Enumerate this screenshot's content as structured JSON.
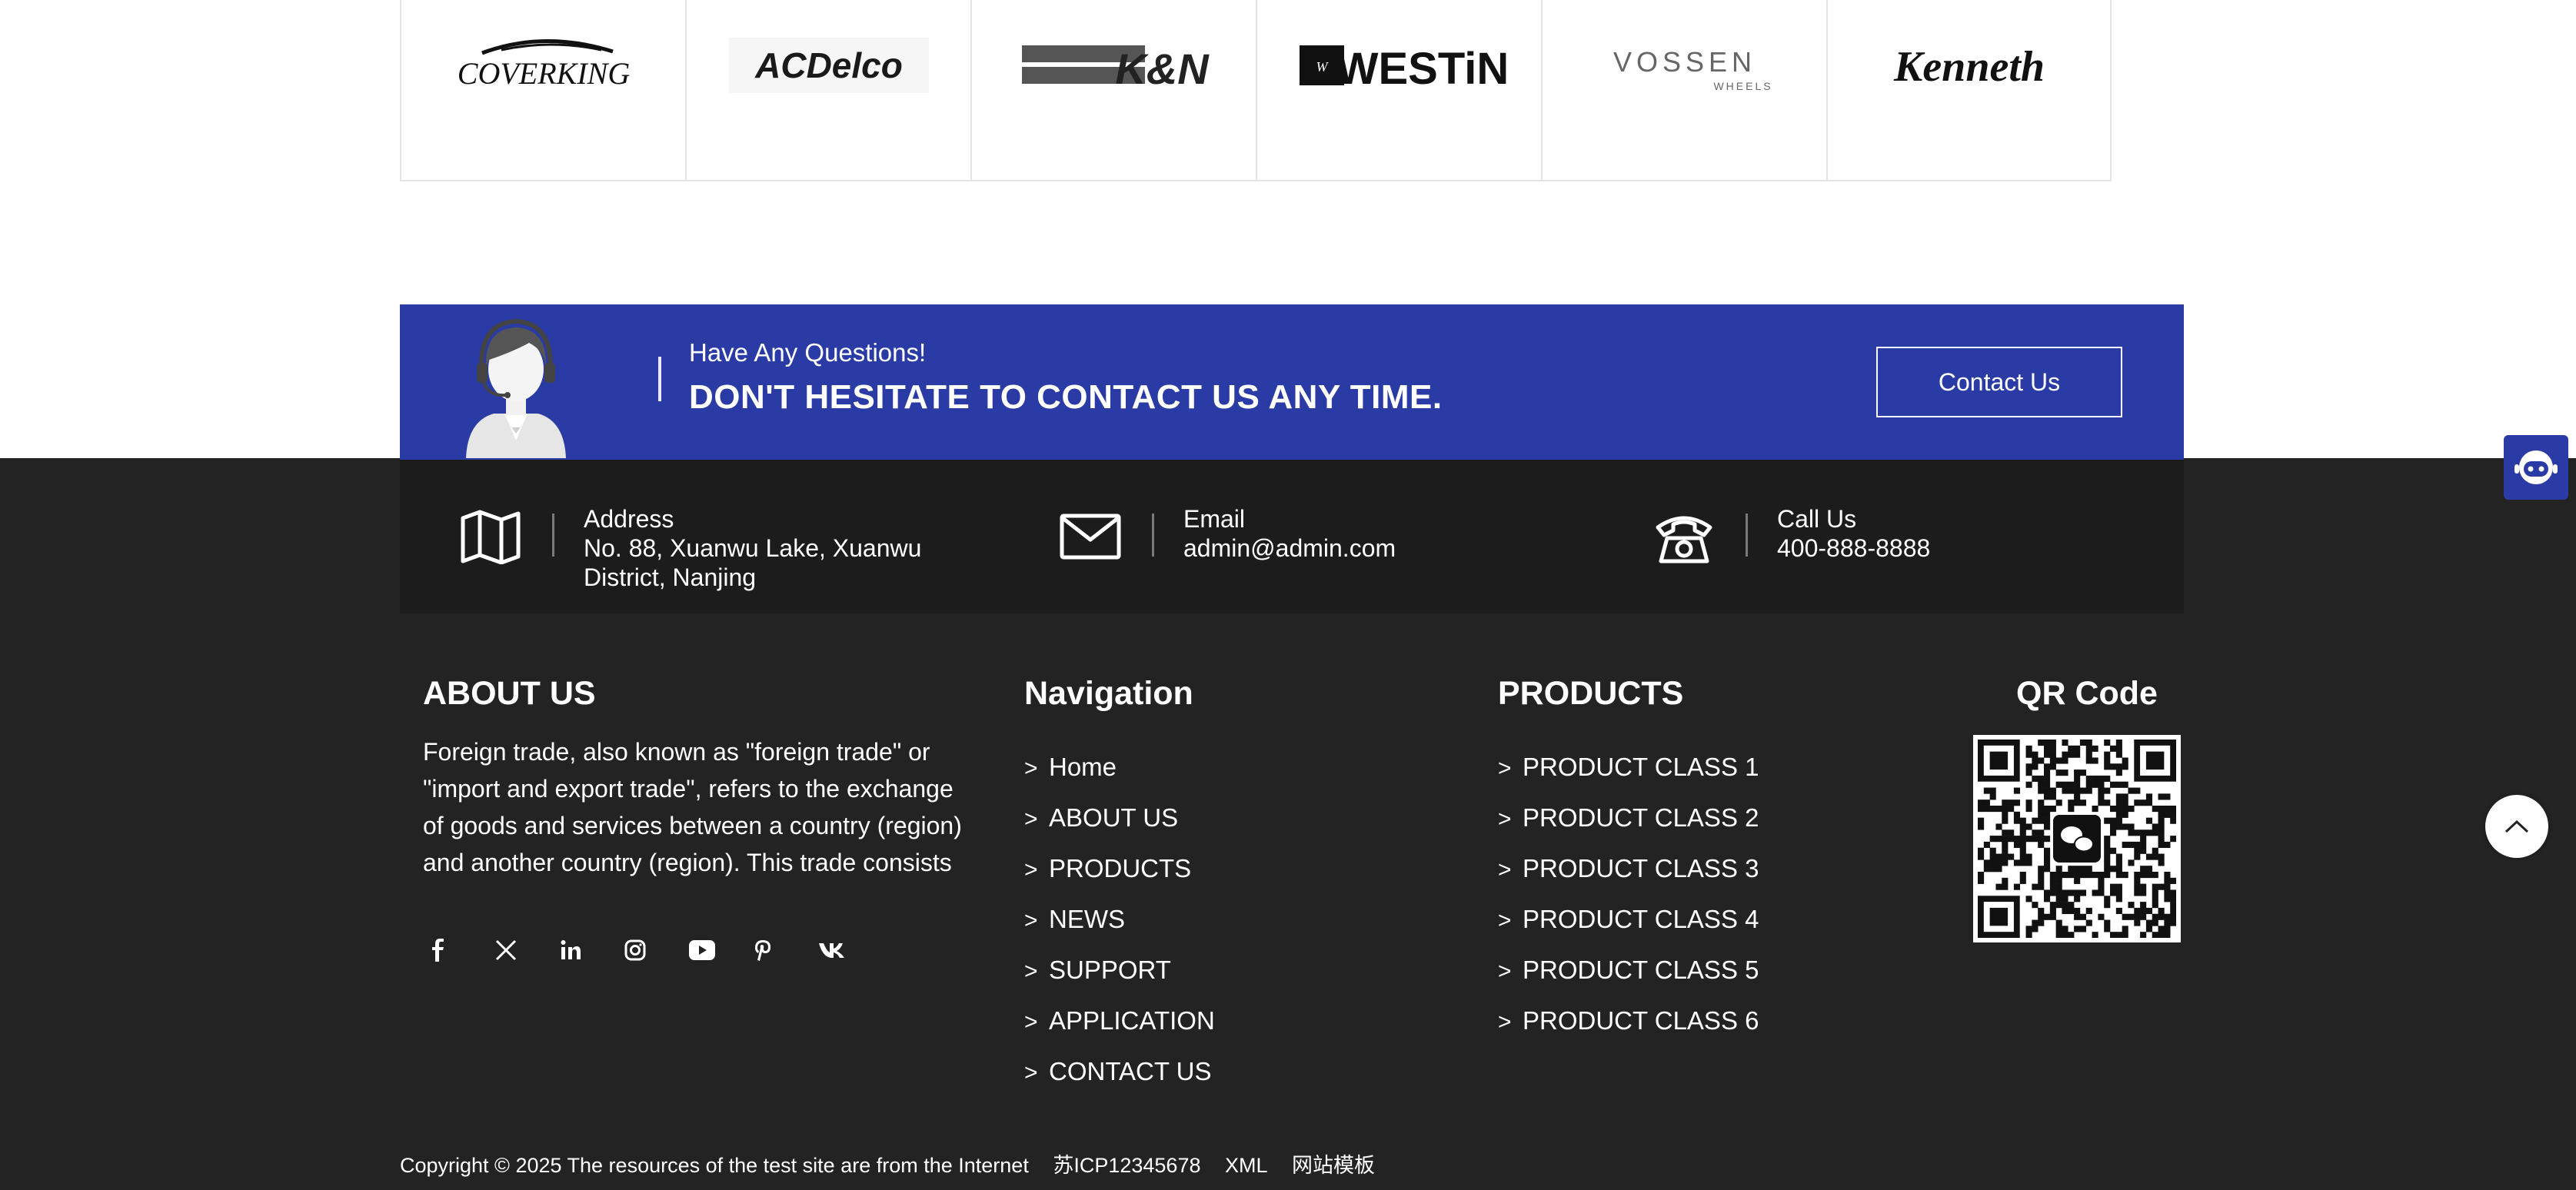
{
  "brands": [
    {
      "name": "COVERKING"
    },
    {
      "name": "ACDelco"
    },
    {
      "name": "K&N"
    },
    {
      "name": "WESTiN"
    },
    {
      "name": "VOSSEN",
      "sub": "WHEELS"
    },
    {
      "name": "Kenneth"
    }
  ],
  "cta": {
    "small": "Have Any Questions!",
    "big": "DON'T HESITATE TO CONTACT US ANY TIME.",
    "button": "Contact Us",
    "accent": "#2a3ba6"
  },
  "contact": {
    "address": {
      "label": "Address",
      "value": "No. 88, Xuanwu Lake, Xuanwu District, Nanjing",
      "icon": "map-icon"
    },
    "email": {
      "label": "Email",
      "value": "admin@admin.com",
      "icon": "envelope-icon"
    },
    "phone": {
      "label": "Call Us",
      "value": "400-888-8888",
      "icon": "phone-icon"
    }
  },
  "about": {
    "title": "ABOUT US",
    "text": "Foreign trade, also known as \"foreign trade\" or \"import and export trade\", refers to the exchange of goods and services between a country (region) and another country (region). This trade consists of two parts: import and export.",
    "social": [
      "facebook-icon",
      "x-icon",
      "linkedin-icon",
      "instagram-icon",
      "youtube-icon",
      "pinterest-icon",
      "vk-icon"
    ]
  },
  "navigation": {
    "title": "Navigation",
    "arrow": ">",
    "items": [
      "Home",
      "ABOUT US",
      "PRODUCTS",
      "NEWS",
      "SUPPORT",
      "APPLICATION",
      "CONTACT US"
    ]
  },
  "products": {
    "title": "PRODUCTS",
    "arrow": ">",
    "items": [
      "PRODUCT CLASS 1",
      "PRODUCT CLASS 2",
      "PRODUCT CLASS 3",
      "PRODUCT CLASS 4",
      "PRODUCT CLASS 5",
      "PRODUCT CLASS 6"
    ]
  },
  "qr": {
    "title": "QR Code",
    "icon": "wechat-icon"
  },
  "copyright": {
    "text": "Copyright © 2025 The resources of the test site are from the Internet",
    "icp": "苏ICP12345678",
    "xml": "XML",
    "template": "网站模板"
  },
  "colors": {
    "footer_bg": "#232323",
    "strip_bg": "#1c1c1c",
    "cta_bg": "#2a3ba6"
  }
}
